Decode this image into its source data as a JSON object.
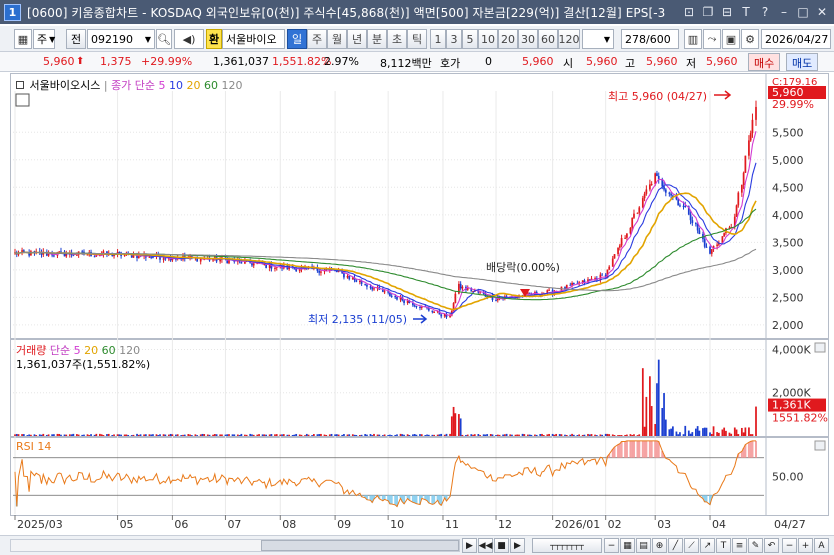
{
  "window": {
    "app_number": "1",
    "title": "[0600] 키움종합차트 - KOSDAQ 외국인보유[0(천)] 주식수[45,868(천)] 액면[500] 자본금[229(억)] 결산[12월] EPS[-3"
  },
  "toolbar": {
    "market": "주",
    "mode": "전",
    "code": "092190",
    "stock_name_prefix": "환",
    "stock_name": "서울바이오",
    "periods": [
      "일",
      "주",
      "월",
      "년",
      "분",
      "초",
      "틱"
    ],
    "active_period": "일",
    "intervals": [
      "1",
      "3",
      "5",
      "10",
      "20",
      "30",
      "60",
      "120"
    ],
    "count": "278",
    "count_total": "/600",
    "date": "2026/04/27"
  },
  "quote": {
    "price": "5,960",
    "change": "1,375",
    "change_pct": "+29.99%",
    "volume": "1,361,037",
    "volume_pct": "1,551.82%",
    "turnover_pct": "2.97%",
    "amount": "8,112백만",
    "hoga_label": "호가",
    "hoga_value": "0",
    "hoga_price": "5,960",
    "open_label": "시",
    "open": "5,960",
    "high_label": "고",
    "high": "5,960",
    "low_label": "저",
    "low": "5,960",
    "buy_label": "매수",
    "sell_label": "매도"
  },
  "price_pane": {
    "legend_name": "서울바이오시스",
    "legend_ma_label": "종가 단순",
    "ma_periods": [
      "5",
      "10",
      "20",
      "60",
      "120"
    ],
    "ma_colors": [
      "#d23cd2",
      "#2a3ce0",
      "#e2a400",
      "#2e8b2e",
      "#8a8a8a"
    ],
    "high_annotation": "최고 5,960 (04/27)",
    "low_annotation": "최저 2,135 (11/05)",
    "dividend_annotation": "배당락(0.00%)",
    "top_label": "C:179.16",
    "current_price_tag": "5,960",
    "current_pct_tag": "29.99%"
  },
  "volume_pane": {
    "legend_label": "거래량",
    "legend_ma_label": "단순",
    "ma_periods": [
      "5",
      "20",
      "60",
      "120"
    ],
    "ma_colors": [
      "#d23cd2",
      "#e2a400",
      "#2e8b2e",
      "#8a8a8a"
    ],
    "summary": "1,361,037주(1,551.82%)",
    "current_tag": "1,361K",
    "current_pct_tag": "1551.82%"
  },
  "rsi_pane": {
    "legend_label": "RSI 14",
    "level_label": "50.00"
  },
  "x_axis": [
    "2025/03",
    "05",
    "06",
    "07",
    "08",
    "09",
    "10",
    "11",
    "12",
    "2026/01",
    "02",
    "03",
    "04",
    "04/27"
  ],
  "colors": {
    "up": "#e0191e",
    "down": "#1b3fd1",
    "rsi_line": "#e97a1a",
    "rsi_fill_low": "#8fd1f0",
    "rsi_fill_high": "#f5a3a3"
  },
  "chart_data": {
    "type": "candlestick",
    "title": "",
    "y_axis_ticks": [
      2000,
      2500,
      3000,
      3500,
      4000,
      4500,
      5000,
      5500
    ],
    "y_range": [
      1780,
      6250
    ],
    "key_points": [
      {
        "date": "2025-03-04",
        "close": 3300
      },
      {
        "date": "2025-05-01",
        "close": 3280
      },
      {
        "date": "2025-07-01",
        "close": 3180
      },
      {
        "date": "2025-08-01",
        "close": 3050
      },
      {
        "date": "2025-09-01",
        "close": 2980
      },
      {
        "date": "2025-10-01",
        "close": 2560
      },
      {
        "date": "2025-11-05",
        "close": 2135
      },
      {
        "date": "2025-11-10",
        "close": 2700
      },
      {
        "date": "2025-12-01",
        "close": 2480
      },
      {
        "date": "2026-01-02",
        "close": 2600
      },
      {
        "date": "2026-02-01",
        "close": 2900
      },
      {
        "date": "2026-03-01",
        "close": 4700
      },
      {
        "date": "2026-03-20",
        "close": 4050
      },
      {
        "date": "2026-04-01",
        "close": 3300
      },
      {
        "date": "2026-04-15",
        "close": 3900
      },
      {
        "date": "2026-04-27",
        "close": 5960
      }
    ],
    "period_high": 5960,
    "period_low": 2135,
    "volume_axis_ticks": [
      "2,000K",
      "4,000K"
    ],
    "rsi_axis_ticks": [
      "50.00"
    ]
  }
}
